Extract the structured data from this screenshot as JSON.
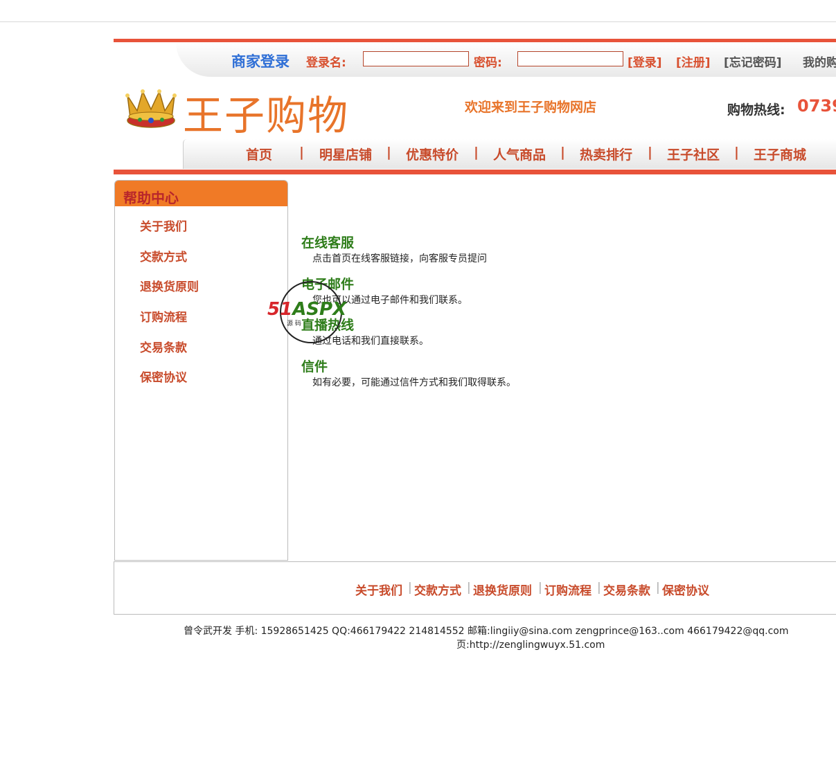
{
  "login": {
    "title": "商家登录",
    "username_label": "登录名:",
    "username_value": "",
    "password_label": "密码:",
    "password_value": "",
    "login_link": "[登录]",
    "register_link": "[注册]",
    "forgot_link": "[忘记密码]",
    "my_link": "我的购"
  },
  "brand": {
    "name": "王子购物",
    "logo_icon": "crown-icon",
    "welcome": "欢迎来到王子购物网店",
    "hotline_label": "购物热线:",
    "hotline_number": "0739"
  },
  "nav": {
    "items": [
      "首页",
      "明星店铺",
      "优惠特价",
      "人气商品",
      "热卖排行",
      "王子社区",
      "王子商城"
    ],
    "separator": "|"
  },
  "sidebar": {
    "title": "帮助中心",
    "items": [
      "关于我们",
      "交款方式",
      "退换货原则",
      "订购流程",
      "交易条款",
      "保密协议"
    ]
  },
  "content": {
    "sections": [
      {
        "title": "在线客服",
        "desc": "点击首页在线客服链接，向客服专员提问"
      },
      {
        "title": "电子邮件",
        "desc": "您也可以通过电子邮件和我们联系。"
      },
      {
        "title": "直播热线",
        "desc": "通过电话和我们直接联系。"
      },
      {
        "title": "信件",
        "desc": "如有必要，可能通过信件方式和我们取得联系。"
      }
    ],
    "watermark": {
      "part1": "51",
      "part2": "ASPX",
      "sub": "源 码"
    }
  },
  "footer": {
    "links": [
      "关于我们",
      "交款方式",
      "退换货原则",
      "订购流程",
      "交易条款",
      "保密协议"
    ],
    "copyright_line1": "曾令武开发   手机: 15928651425   QQ:466179422   214814552   邮箱:lingiiy@sina.com  zengprince@163..com  466179422@qq.com",
    "copyright_line2": "页:http://zenglingwuyx.51.com"
  },
  "colors": {
    "accent_red": "#e8533a",
    "orange": "#e8742a",
    "link_red": "#c84b2b",
    "green": "#2e7d1a",
    "login_blue": "#2f6fd6"
  }
}
